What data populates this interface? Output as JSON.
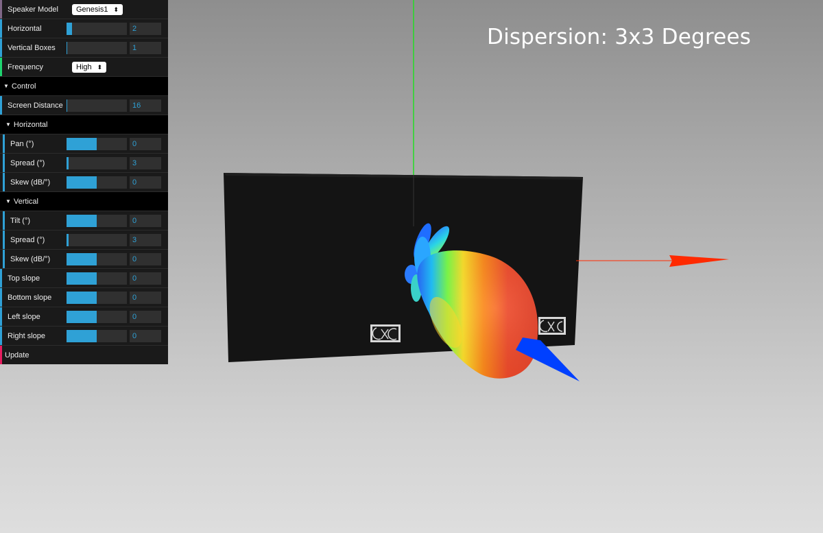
{
  "title": "Dispersion: 3x3 Degrees",
  "gui": {
    "speaker_model": {
      "label": "Speaker Model",
      "value": "Genesis1"
    },
    "horizontal": {
      "label": "Horizontal",
      "value": "2",
      "fill": 0.09
    },
    "vertical_boxes": {
      "label": "Vertical Boxes",
      "value": "1",
      "fill": 0
    },
    "frequency": {
      "label": "Frequency",
      "value": "High"
    },
    "control_folder": "Control",
    "screen_distance": {
      "label": "Screen Distance",
      "value": "16",
      "fill": 0
    },
    "horizontal_folder": "Horizontal",
    "h_pan": {
      "label": "Pan (°)",
      "value": "0",
      "fill": 0.5
    },
    "h_spread": {
      "label": "Spread (°)",
      "value": "3",
      "fill": 0.02
    },
    "h_skew": {
      "label": "Skew (dB/°)",
      "value": "0",
      "fill": 0.5
    },
    "vertical_folder": "Vertical",
    "v_tilt": {
      "label": "Tilt (°)",
      "value": "0",
      "fill": 0.5
    },
    "v_spread": {
      "label": "Spread (°)",
      "value": "3",
      "fill": 0.02
    },
    "v_skew": {
      "label": "Skew (dB/°)",
      "value": "0",
      "fill": 0.5
    },
    "top_slope": {
      "label": "Top slope",
      "value": "0",
      "fill": 0.5
    },
    "bottom_slope": {
      "label": "Bottom slope",
      "value": "0",
      "fill": 0.5
    },
    "left_slope": {
      "label": "Left slope",
      "value": "0",
      "fill": 0.5
    },
    "right_slope": {
      "label": "Right slope",
      "value": "0",
      "fill": 0.5
    },
    "update_label": "Update"
  },
  "logo_text": "EXC",
  "colors": {
    "accent": "#2fa1d6",
    "panel": "#1a1a1a",
    "axis_x": "#ff2a00",
    "axis_y": "#22dd22",
    "axis_z": "#0044ff"
  }
}
